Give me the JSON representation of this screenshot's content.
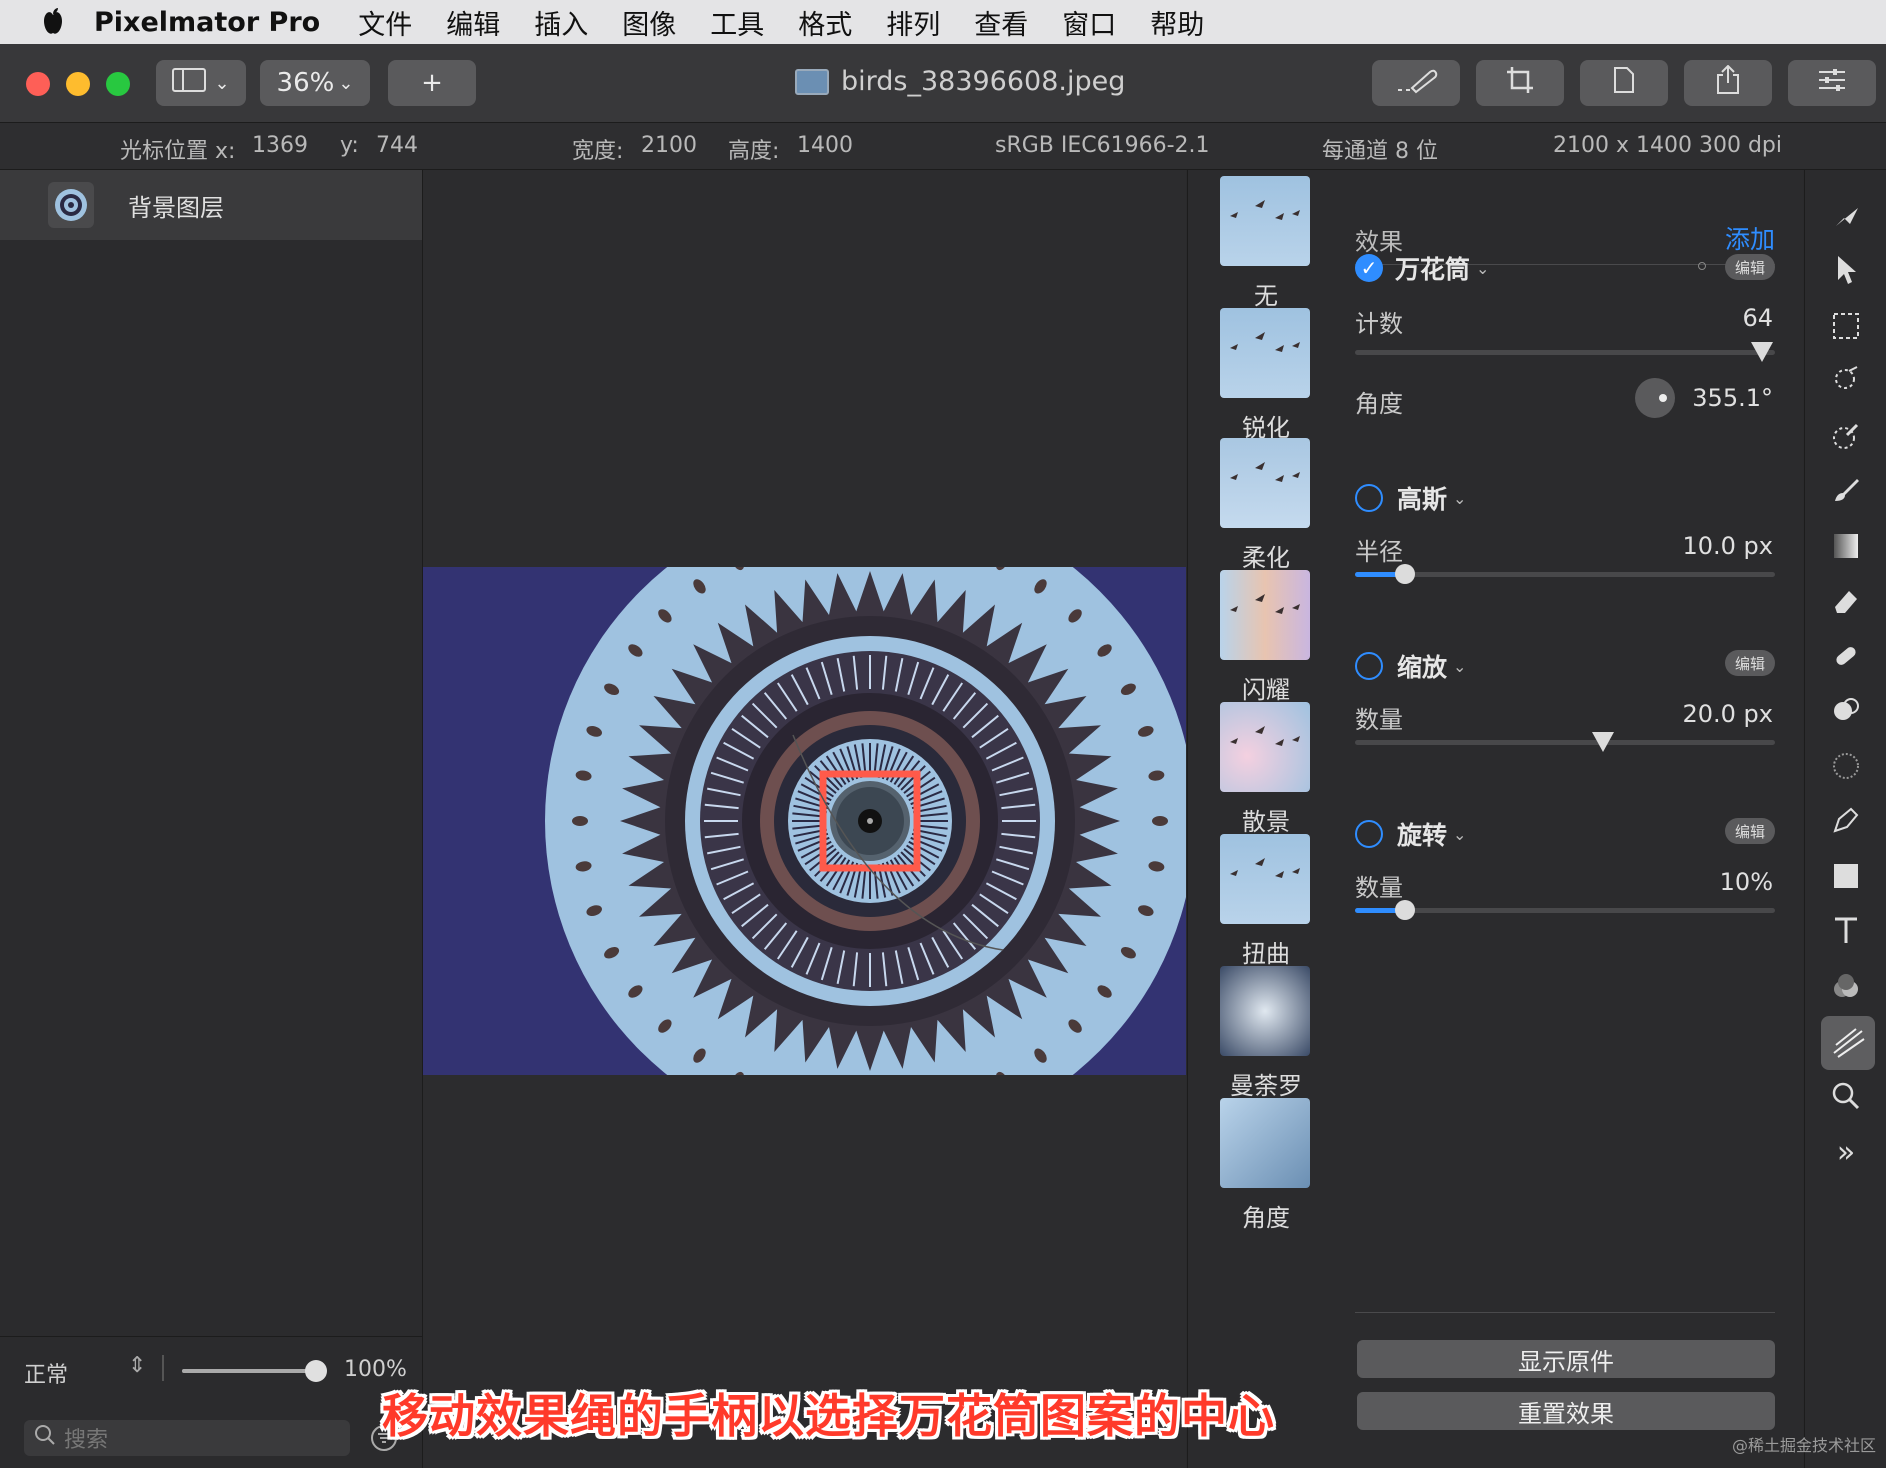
{
  "menubar": {
    "app_name": "Pixelmator Pro",
    "items": [
      "文件",
      "编辑",
      "插入",
      "图像",
      "工具",
      "格式",
      "排列",
      "查看",
      "窗口",
      "帮助"
    ]
  },
  "toolbar": {
    "zoom": "36%",
    "add_label": "+",
    "document_title": "birds_38396608.jpeg"
  },
  "infobar": {
    "cursor_label": "光标位置 x:",
    "cursor_x": "1369",
    "y_label": "y:",
    "cursor_y": "744",
    "width_label": "宽度:",
    "width_value": "2100",
    "height_label": "高度:",
    "height_value": "1400",
    "color_profile": "sRGB IEC61966-2.1",
    "bit_depth": "每通道 8 位",
    "resolution": "2100 x 1400 300 dpi"
  },
  "layers": {
    "items": [
      {
        "name": "背景图层"
      }
    ],
    "blend_mode": "正常",
    "opacity": "100%",
    "opacity_fraction": 1.0,
    "search_placeholder": "搜索"
  },
  "effects_browser": {
    "items": [
      {
        "label": "无"
      },
      {
        "label": "锐化"
      },
      {
        "label": "柔化"
      },
      {
        "label": "闪耀"
      },
      {
        "label": "散景"
      },
      {
        "label": "扭曲"
      },
      {
        "label": "曼荼罗"
      },
      {
        "label": "角度"
      }
    ]
  },
  "settings": {
    "header": "效果",
    "add_label": "添加",
    "edit_label": "编辑",
    "kaleidoscope": {
      "name": "万花筒",
      "enabled": true,
      "count_label": "计数",
      "count_value": "64",
      "count_fraction": 0.97,
      "angle_label": "角度",
      "angle_value": "355.1°"
    },
    "gaussian": {
      "name": "高斯",
      "enabled": false,
      "radius_label": "半径",
      "radius_value": "10.0 px",
      "radius_fraction": 0.12
    },
    "zoom": {
      "name": "缩放",
      "enabled": false,
      "amount_label": "数量",
      "amount_value": "20.0 px",
      "amount_fraction": 0.59
    },
    "twirl": {
      "name": "旋转",
      "enabled": false,
      "amount_label": "数量",
      "amount_value": "10%",
      "amount_fraction": 0.12
    },
    "show_original_label": "显示原件",
    "reset_label": "重置效果"
  },
  "tools": {
    "expand_label": "»"
  },
  "caption": "移动效果绳的手柄以选择万花筒图案的中心",
  "watermark": "@稀土掘金技术社区",
  "colors": {
    "accent": "#2f8dff",
    "highlight_box": "#ff5a4a",
    "image_bg": "#333372",
    "kaleido_light": "#9fc2e0"
  }
}
